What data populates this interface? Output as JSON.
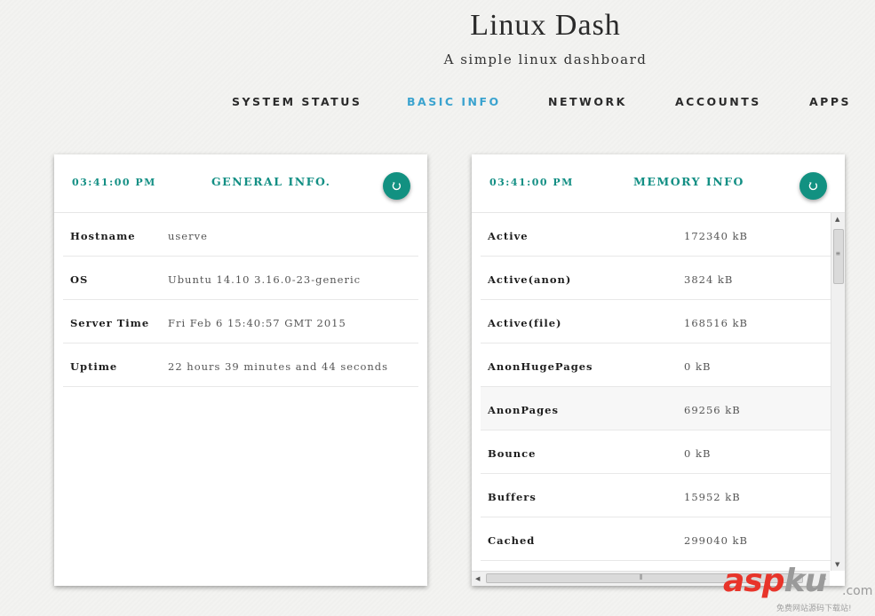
{
  "app": {
    "title": "Linux Dash",
    "subtitle": "A simple linux dashboard"
  },
  "nav": {
    "active": "BASIC INFO",
    "items": [
      "SYSTEM STATUS",
      "BASIC INFO",
      "NETWORK",
      "ACCOUNTS",
      "APPS"
    ]
  },
  "general": {
    "time": "03:41:00 PM",
    "title": "GENERAL INFO.",
    "rows": [
      {
        "key": "Hostname",
        "value": "userve"
      },
      {
        "key": "OS",
        "value": "Ubuntu 14.10 3.16.0-23-generic"
      },
      {
        "key": "Server Time",
        "value": "Fri Feb 6 15:40:57 GMT 2015"
      },
      {
        "key": "Uptime",
        "value": "22 hours 39 minutes and 44 seconds"
      }
    ]
  },
  "memory": {
    "time": "03:41:00 PM",
    "title": "MEMORY INFO",
    "rows": [
      {
        "key": "Active",
        "value": "172340 kB"
      },
      {
        "key": "Active(anon)",
        "value": "3824 kB"
      },
      {
        "key": "Active(file)",
        "value": "168516 kB"
      },
      {
        "key": "AnonHugePages",
        "value": "0 kB"
      },
      {
        "key": "AnonPages",
        "value": "69256 kB"
      },
      {
        "key": "Bounce",
        "value": "0 kB"
      },
      {
        "key": "Buffers",
        "value": "15952 kB"
      },
      {
        "key": "Cached",
        "value": "299040 kB"
      }
    ]
  },
  "icons": {
    "refresh": "refresh-icon"
  },
  "colors": {
    "accent": "#129181",
    "nav_active": "#3ba3cf"
  },
  "watermark": {
    "brand_red": "asp",
    "brand_gray": "ku",
    "tld": ".com",
    "tagline": "免费网站源码下载站!"
  }
}
